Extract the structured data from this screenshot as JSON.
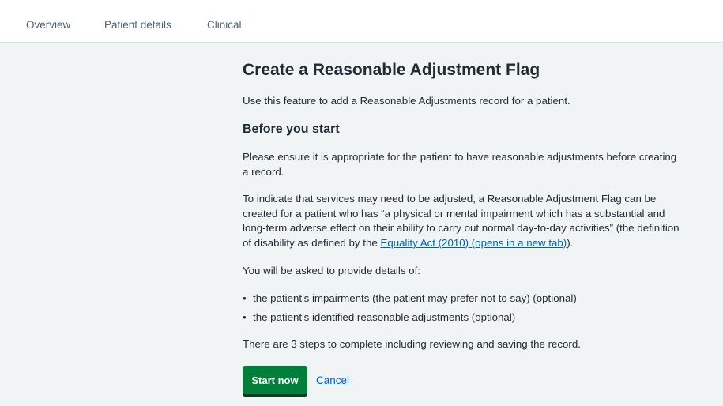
{
  "nav": {
    "tabs": [
      {
        "label": "Overview"
      },
      {
        "label": "Patient details"
      },
      {
        "label": "Clinical"
      }
    ]
  },
  "main": {
    "title": "Create a Reasonable Adjustment Flag",
    "intro": "Use this feature to add a Reasonable Adjustments record for a patient.",
    "before_heading": "Before you start",
    "ensure_text": "Please ensure it is appropriate for the patient to have reasonable adjustments before creating a record.",
    "indicate_text_before_link": "To indicate that services may need to be adjusted, a Reasonable Adjustment Flag can be created for a patient who has “a physical or mental impairment which has a substantial and long-term adverse effect on their ability to carry out normal day-to-day activities” (the definition of disability as defined by the ",
    "equality_link": "Equality Act (2010) (opens in a new tab)",
    "indicate_text_after_link": ").",
    "details_intro": "You will be asked to provide details of:",
    "details_items": [
      {
        "text": "the patient's impairments (the patient may prefer not to say) (optional)"
      },
      {
        "text": "the patient's identified reasonable adjustments (optional)"
      }
    ],
    "steps_text": "There are 3 steps to complete including reviewing and saving the record.",
    "start_button": "Start now",
    "cancel_link": "Cancel"
  }
}
